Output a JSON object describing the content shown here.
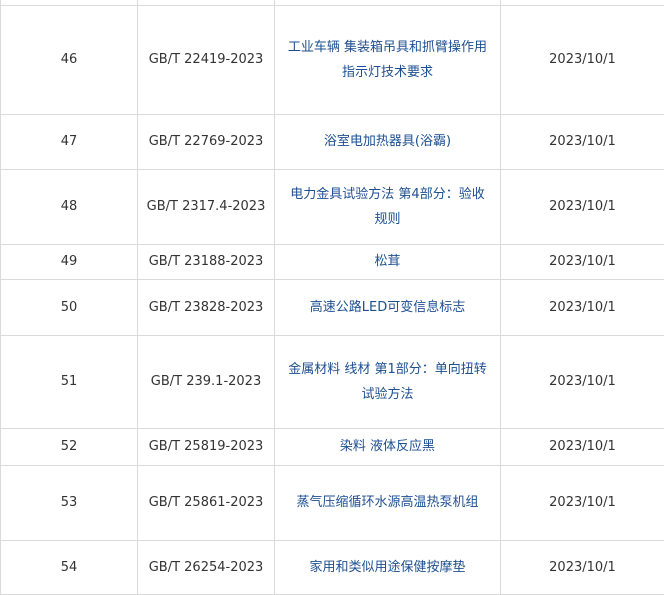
{
  "table": {
    "rows": [
      {
        "seq": "",
        "std_no": "",
        "title": "",
        "date": ""
      },
      {
        "seq": "46",
        "std_no": "GB/T 22419-2023",
        "title": "工业车辆 集装箱吊具和抓臂操作用指示灯技术要求",
        "date": "2023/10/1"
      },
      {
        "seq": "47",
        "std_no": "GB/T 22769-2023",
        "title": "浴室电加热器具(浴霸)",
        "date": "2023/10/1"
      },
      {
        "seq": "48",
        "std_no": "GB/T 2317.4-2023",
        "title": "电力金具试验方法 第4部分：验收规则",
        "date": "2023/10/1"
      },
      {
        "seq": "49",
        "std_no": "GB/T 23188-2023",
        "title": "松茸",
        "date": "2023/10/1"
      },
      {
        "seq": "50",
        "std_no": "GB/T 23828-2023",
        "title": "高速公路LED可变信息标志",
        "date": "2023/10/1"
      },
      {
        "seq": "51",
        "std_no": "GB/T 239.1-2023",
        "title": "金属材料 线材 第1部分：单向扭转试验方法",
        "date": "2023/10/1"
      },
      {
        "seq": "52",
        "std_no": "GB/T 25819-2023",
        "title": "染料 液体反应黑",
        "date": "2023/10/1"
      },
      {
        "seq": "53",
        "std_no": "GB/T 25861-2023",
        "title": "蒸气压缩循环水源高温热泵机组",
        "date": "2023/10/1"
      },
      {
        "seq": "54",
        "std_no": "GB/T 26254-2023",
        "title": "家用和类似用途保健按摩垫",
        "date": "2023/10/1"
      }
    ]
  }
}
